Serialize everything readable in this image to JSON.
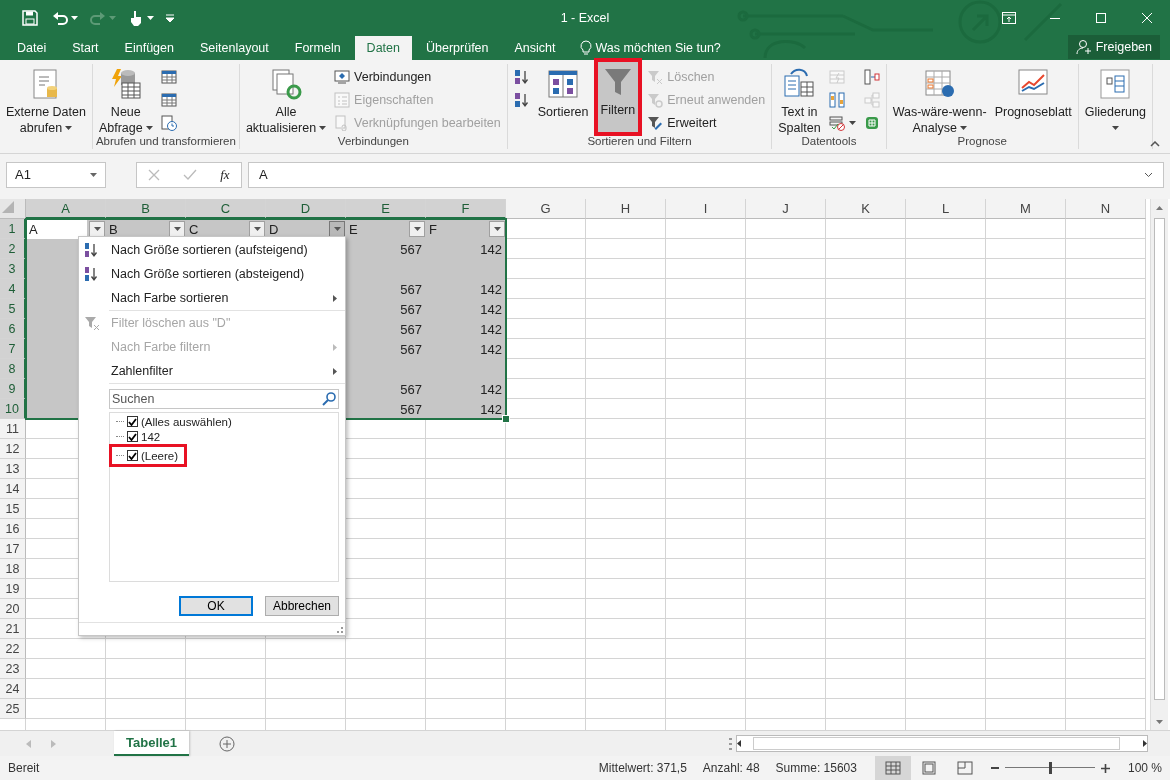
{
  "title_bar": {
    "title": "1 - Excel"
  },
  "tabs": [
    {
      "label": "Datei",
      "selected": false
    },
    {
      "label": "Start",
      "selected": false
    },
    {
      "label": "Einfügen",
      "selected": false
    },
    {
      "label": "Seitenlayout",
      "selected": false
    },
    {
      "label": "Formeln",
      "selected": false
    },
    {
      "label": "Daten",
      "selected": true
    },
    {
      "label": "Überprüfen",
      "selected": false
    },
    {
      "label": "Ansicht",
      "selected": false
    }
  ],
  "tell_me": {
    "placeholder": "Was möchten Sie tun?"
  },
  "share_button": {
    "label": "Freigeben"
  },
  "ribbon_groups": [
    {
      "items": [
        {
          "kind": "large",
          "lines": [
            "Externe Daten",
            "abrufen"
          ],
          "dropdown": true
        }
      ]
    },
    {
      "label": "Abrufen und transformieren",
      "items": [
        {
          "kind": "large",
          "lines": [
            "Neue",
            "Abfrage"
          ],
          "dropdown": true
        },
        {
          "kind": "stack",
          "entries": [
            {
              "disabled": false
            },
            {
              "disabled": false
            },
            {
              "disabled": false
            }
          ]
        }
      ]
    },
    {
      "label": "Verbindungen",
      "items": [
        {
          "kind": "large",
          "lines": [
            "Alle",
            "aktualisieren"
          ],
          "dropdown": true
        },
        {
          "kind": "stack",
          "entries": [
            {
              "label": "Verbindungen",
              "disabled": false
            },
            {
              "label": "Eigenschaften",
              "disabled": true
            },
            {
              "label": "Verknüpfungen bearbeiten",
              "disabled": true
            }
          ]
        }
      ]
    },
    {
      "label": "Sortieren und Filtern",
      "items": [
        {
          "kind": "stack",
          "entries": [
            {
              "disabled": false
            },
            {
              "disabled": false
            }
          ]
        },
        {
          "kind": "large",
          "lines": [
            "Sortieren"
          ]
        },
        {
          "kind": "large",
          "lines": [
            "Filtern"
          ],
          "pressed": true,
          "highlighted": true
        },
        {
          "kind": "stack",
          "entries": [
            {
              "label": "Löschen",
              "disabled": true
            },
            {
              "label": "Erneut anwenden",
              "disabled": true
            },
            {
              "label": "Erweitert",
              "disabled": false
            }
          ]
        }
      ]
    },
    {
      "label": "Datentools",
      "items": [
        {
          "kind": "large",
          "lines": [
            "Text in",
            "Spalten"
          ]
        },
        {
          "kind": "stack",
          "entries": [
            {
              "disabled": true
            },
            {
              "disabled": false
            },
            {
              "disabled": false,
              "dropdown": true
            }
          ]
        },
        {
          "kind": "stack",
          "entries": [
            {
              "disabled": false
            },
            {
              "disabled": true
            },
            {
              "disabled": false
            }
          ]
        }
      ]
    },
    {
      "label": "Prognose",
      "items": [
        {
          "kind": "large",
          "lines": [
            "Was-wäre-wenn-",
            "Analyse"
          ],
          "dropdown": true
        },
        {
          "kind": "large",
          "lines": [
            "Prognoseblatt"
          ]
        }
      ]
    },
    {
      "items": [
        {
          "kind": "large",
          "lines": [
            "Gliederung"
          ],
          "dropdown": true
        }
      ]
    }
  ],
  "formula_bar": {
    "name_box": "A1",
    "function_label": "fx",
    "formula": "A"
  },
  "sheet": {
    "columns": [
      {
        "label": "A",
        "selected": true
      },
      {
        "label": "B",
        "selected": true
      },
      {
        "label": "C",
        "selected": true
      },
      {
        "label": "D",
        "selected": true
      },
      {
        "label": "E",
        "selected": true
      },
      {
        "label": "F",
        "selected": true
      },
      {
        "label": "G",
        "selected": false
      },
      {
        "label": "H",
        "selected": false
      },
      {
        "label": "I",
        "selected": false
      },
      {
        "label": "J",
        "selected": false
      },
      {
        "label": "K",
        "selected": false
      },
      {
        "label": "L",
        "selected": false
      },
      {
        "label": "M",
        "selected": false
      },
      {
        "label": "N",
        "selected": false
      }
    ],
    "filter_buttons": [
      {
        "active": false
      },
      {
        "active": false
      },
      {
        "active": false
      },
      {
        "active": true
      },
      {
        "active": false
      },
      {
        "active": false
      }
    ],
    "rows": [
      {
        "header": "1",
        "selected": true,
        "cells": [
          "A",
          "B",
          "C",
          "D",
          "E",
          "F"
        ]
      },
      {
        "header": "2",
        "selected": true,
        "cells": [
          null,
          null,
          null,
          null,
          "567",
          "142"
        ]
      },
      {
        "header": "3",
        "selected": true,
        "cells": []
      },
      {
        "header": "4",
        "selected": true,
        "cells": [
          null,
          null,
          null,
          null,
          "567",
          "142"
        ]
      },
      {
        "header": "5",
        "selected": true,
        "cells": [
          null,
          null,
          null,
          null,
          "567",
          "142"
        ]
      },
      {
        "header": "6",
        "selected": true,
        "cells": [
          null,
          null,
          null,
          null,
          "567",
          "142"
        ]
      },
      {
        "header": "7",
        "selected": true,
        "cells": [
          null,
          null,
          null,
          null,
          "567",
          "142"
        ]
      },
      {
        "header": "8",
        "selected": true,
        "cells": []
      },
      {
        "header": "9",
        "selected": true,
        "cells": [
          null,
          null,
          null,
          null,
          "567",
          "142"
        ]
      },
      {
        "header": "10",
        "selected": true,
        "cells": [
          null,
          null,
          null,
          null,
          "567",
          "142"
        ]
      },
      {
        "header": "11",
        "selected": false,
        "cells": []
      },
      {
        "header": "12",
        "selected": false,
        "cells": []
      },
      {
        "header": "13",
        "selected": false,
        "cells": []
      },
      {
        "header": "14",
        "selected": false,
        "cells": []
      },
      {
        "header": "15",
        "selected": false,
        "cells": []
      },
      {
        "header": "16",
        "selected": false,
        "cells": []
      },
      {
        "header": "17",
        "selected": false,
        "cells": []
      },
      {
        "header": "18",
        "selected": false,
        "cells": []
      },
      {
        "header": "19",
        "selected": false,
        "cells": []
      },
      {
        "header": "20",
        "selected": false,
        "cells": []
      },
      {
        "header": "21",
        "selected": false,
        "cells": []
      },
      {
        "header": "22",
        "selected": false,
        "cells": []
      },
      {
        "header": "23",
        "selected": false,
        "cells": []
      },
      {
        "header": "24",
        "selected": false,
        "cells": []
      },
      {
        "header": "25",
        "selected": false,
        "cells": []
      }
    ]
  },
  "filter_menu": {
    "items": [
      {
        "kind": "sort_ascending",
        "label": "Nach Größe sortieren (aufsteigend)",
        "disabled": false
      },
      {
        "kind": "sort_descending",
        "label": "Nach Größe sortieren (absteigend)",
        "disabled": false
      },
      {
        "kind": "command",
        "label": "Nach Farbe sortieren",
        "disabled": false,
        "submenu": true
      },
      {
        "kind": "separator"
      },
      {
        "kind": "clear_filter",
        "label": "Filter löschen aus \"D\"",
        "disabled": true
      },
      {
        "kind": "command",
        "label": "Nach Farbe filtern",
        "disabled": true,
        "submenu": true
      },
      {
        "kind": "command",
        "label": "Zahlenfilter",
        "disabled": false,
        "submenu": true
      },
      {
        "kind": "separator"
      }
    ],
    "search": {
      "placeholder": "Suchen"
    },
    "values": [
      {
        "label": "(Alles auswählen)",
        "checked": true,
        "highlighted": false
      },
      {
        "label": "142",
        "checked": true,
        "highlighted": false
      },
      {
        "label": "(Leere)",
        "checked": true,
        "highlighted": true
      }
    ],
    "buttons": [
      {
        "label": "OK",
        "default": true
      },
      {
        "label": "Abbrechen",
        "default": false
      }
    ]
  },
  "sheet_tabs": [
    {
      "label": "Tabelle1",
      "selected": true
    }
  ],
  "status_bar": {
    "mode": "Bereit",
    "stats": [
      "Mittelwert: 371,5",
      "Anzahl: 48",
      "Summe: 15603"
    ],
    "views": [
      {
        "selected": true
      },
      {
        "selected": false
      },
      {
        "selected": false
      }
    ],
    "zoom": {
      "level": 0.5,
      "label": "100 %"
    }
  }
}
